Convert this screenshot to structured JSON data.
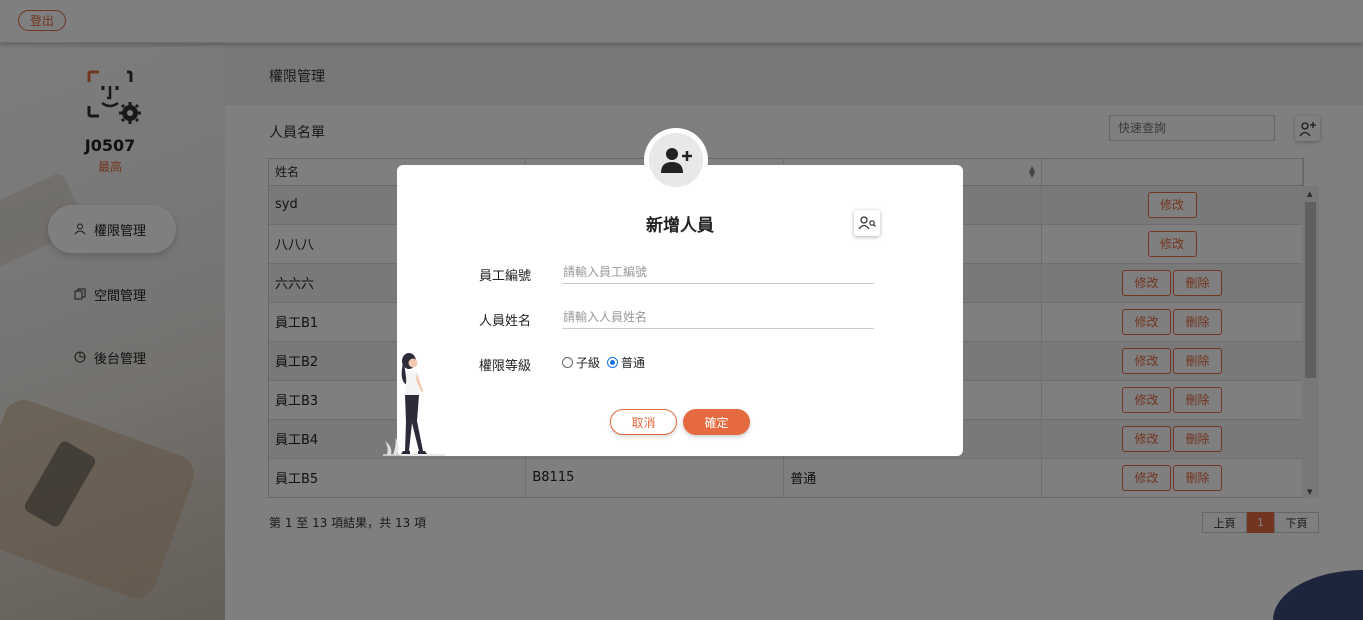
{
  "topbar": {
    "logout_label": "登出"
  },
  "sidebar": {
    "account_name": "J0507",
    "account_role": "最高",
    "items": [
      {
        "label": "權限管理",
        "icon": "user-icon",
        "active": true
      },
      {
        "label": "空間管理",
        "icon": "copy-icon",
        "active": false
      },
      {
        "label": "後台管理",
        "icon": "pie-chart-icon",
        "active": false
      }
    ]
  },
  "main": {
    "breadcrumb": "權限管理",
    "list_title": "人員名單",
    "search_placeholder": "快速查詢",
    "table": {
      "headers": [
        "姓名",
        "",
        "",
        ""
      ],
      "rows": [
        {
          "name": "syd",
          "id": "",
          "level": "",
          "actions": [
            "修改"
          ]
        },
        {
          "name": "八八八",
          "id": "",
          "level": "",
          "actions": [
            "修改"
          ]
        },
        {
          "name": "六六六",
          "id": "",
          "level": "",
          "actions": [
            "修改",
            "刪除"
          ]
        },
        {
          "name": "員工B1",
          "id": "",
          "level": "",
          "actions": [
            "修改",
            "刪除"
          ]
        },
        {
          "name": "員工B2",
          "id": "",
          "level": "",
          "actions": [
            "修改",
            "刪除"
          ]
        },
        {
          "name": "員工B3",
          "id": "",
          "level": "",
          "actions": [
            "修改",
            "刪除"
          ]
        },
        {
          "name": "員工B4",
          "id": "",
          "level": "",
          "actions": [
            "修改",
            "刪除"
          ]
        },
        {
          "name": "員工B5",
          "id": "B8115",
          "level": "普通",
          "actions": [
            "修改",
            "刪除"
          ]
        }
      ]
    },
    "results_info": "第 1 至 13 項結果，共 13 項",
    "pager": {
      "prev": "上頁",
      "current": "1",
      "next": "下頁"
    }
  },
  "modal": {
    "title": "新增人員",
    "fields": {
      "employee_id": {
        "label": "員工編號",
        "placeholder": "請輸入員工編號"
      },
      "employee_name": {
        "label": "人員姓名",
        "placeholder": "請輸入人員姓名"
      }
    },
    "level": {
      "label": "權限等級",
      "options": [
        {
          "label": "子級",
          "checked": false
        },
        {
          "label": "普通",
          "checked": true
        }
      ]
    },
    "cancel_label": "取消",
    "confirm_label": "確定"
  },
  "colors": {
    "accent": "#e56a3f",
    "radio_checked": "#1a73e8"
  }
}
